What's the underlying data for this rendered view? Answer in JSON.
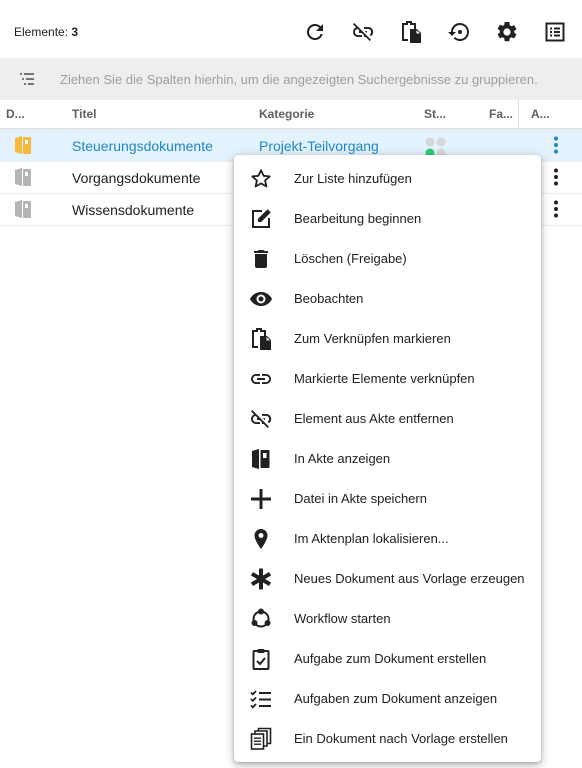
{
  "toolbar": {
    "count_label": "Elemente:",
    "count_value": "3",
    "icons": [
      "refresh-icon",
      "unlink-icon",
      "clipboard-copy-icon",
      "restore-icon",
      "settings-icon",
      "list-view-icon"
    ]
  },
  "group_bar": {
    "text": "Ziehen Sie die Spalten hierhin, um die angezeigten Suchergebnisse zu gruppieren."
  },
  "columns": {
    "doc": "D...",
    "title": "Titel",
    "category": "Kategorie",
    "status": "St...",
    "fa": "Fa...",
    "actions": "A..."
  },
  "rows": [
    {
      "title": "Steuerungsdokumente",
      "category": "Projekt-Teilvorgang",
      "selected": true,
      "icon_color": "#f6b93b"
    },
    {
      "title": "Vorgangsdokumente",
      "category": "",
      "selected": false,
      "icon_color": "#9e9e9e"
    },
    {
      "title": "Wissensdokumente",
      "category": "",
      "selected": false,
      "icon_color": "#9e9e9e"
    }
  ],
  "context_menu": {
    "items": [
      {
        "label": "Zur Liste hinzufügen",
        "icon": "star-outline-icon"
      },
      {
        "label": "Bearbeitung beginnen",
        "icon": "edit-icon"
      },
      {
        "label": "Löschen (Freigabe)",
        "icon": "trash-icon"
      },
      {
        "label": "Beobachten",
        "icon": "eye-icon"
      },
      {
        "label": "Zum Verknüpfen markieren",
        "icon": "clipboard-copy-icon"
      },
      {
        "label": "Markierte Elemente verknüpfen",
        "icon": "link-icon"
      },
      {
        "label": "Element aus Akte entfernen",
        "icon": "unlink-icon"
      },
      {
        "label": "In Akte anzeigen",
        "icon": "binder-icon"
      },
      {
        "label": "Datei in Akte speichern",
        "icon": "plus-icon"
      },
      {
        "label": "Im Aktenplan lokalisieren...",
        "icon": "map-pin-icon"
      },
      {
        "label": "Neues Dokument aus Vorlage erzeugen",
        "icon": "asterisk-icon"
      },
      {
        "label": "Workflow starten",
        "icon": "workflow-icon"
      },
      {
        "label": "Aufgabe zum Dokument erstellen",
        "icon": "clipboard-check-icon"
      },
      {
        "label": "Aufgaben zum Dokument anzeigen",
        "icon": "checklist-icon"
      },
      {
        "label": "Ein Dokument nach Vorlage erstellen",
        "icon": "copy-documents-icon"
      }
    ]
  },
  "colors": {
    "accent": "#1e88c7",
    "selected_row": "#e3f2fd",
    "folder_yellow": "#f6b93b",
    "status_green": "#2ecc71"
  }
}
